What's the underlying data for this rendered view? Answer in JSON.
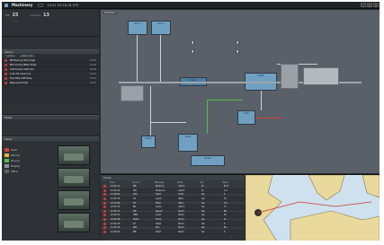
{
  "app": {
    "title": "Machinery",
    "time": "15:51 03-18-19 UTC"
  },
  "readouts": [
    {
      "label": "ME",
      "value": "25"
    },
    {
      "label": "Coolant",
      "value": "13"
    }
  ],
  "alarms": {
    "header": "Alarms",
    "tabs": [
      "Active",
      "Alarm List"
    ],
    "rows": [
      {
        "text": "ME Bearing Temp High",
        "time": "14:22"
      },
      {
        "text": "ME Cooling Water Press",
        "time": "14:19"
      },
      {
        "text": "AUX Engine Start Fail",
        "time": "13:58"
      },
      {
        "text": "Lube Oil Level Low",
        "time": "13:41"
      },
      {
        "text": "Fuel Filter Diff Press",
        "time": "13:12"
      },
      {
        "text": "Bilge Level High",
        "time": "12:57"
      }
    ]
  },
  "panes": {
    "b_header": "Power",
    "c_header": "Views",
    "legend": [
      "Alarm",
      "Warning",
      "Running",
      "Stopped",
      "Offline"
    ]
  },
  "diagram": {
    "title": "Propulsion",
    "labels": [
      "Gen 1",
      "Gen 2",
      "Gear",
      "Shaft",
      "Pump",
      "Valve",
      "Cooler",
      "Tank"
    ]
  },
  "events": {
    "header": "Events",
    "columns": [
      "Time",
      "Source",
      "Message",
      "State",
      "Ack",
      "Value"
    ],
    "rows": [
      [
        "14:22:11",
        "ME",
        "Bearing",
        "Alarm",
        "No",
        "82.5"
      ],
      [
        "14:19:40",
        "CW",
        "Pressure",
        "Alarm",
        "No",
        "1.2"
      ],
      [
        "13:58:02",
        "AE2",
        "Start",
        "Fault",
        "Yes",
        "0"
      ],
      [
        "13:41:55",
        "LO",
        "Level",
        "Warn",
        "Yes",
        "34"
      ],
      [
        "13:12:09",
        "FO",
        "Filter",
        "Warn",
        "Yes",
        "0.8"
      ],
      [
        "12:57:31",
        "BG",
        "Level",
        "Alarm",
        "Yes",
        "71"
      ],
      [
        "12:40:17",
        "ME",
        "Speed",
        "Norm",
        "Yes",
        "88"
      ],
      [
        "12:22:03",
        "GEN",
        "Load",
        "Norm",
        "Yes",
        "64"
      ],
      [
        "12:05:48",
        "HVAC",
        "Temp",
        "Norm",
        "Yes",
        "21"
      ],
      [
        "11:51:26",
        "ST",
        "Steer",
        "Norm",
        "Yes",
        "0"
      ],
      [
        "11:33:14",
        "AE1",
        "Run",
        "Norm",
        "Yes",
        "60"
      ],
      [
        "11:20:02",
        "ME",
        "Start",
        "Norm",
        "Yes",
        "0"
      ]
    ]
  },
  "colors": {
    "alarm": "#d8403c",
    "warning": "#e3b23c",
    "running": "#4cc24a",
    "stopped": "#8a929a",
    "offline": "#5a6168"
  }
}
